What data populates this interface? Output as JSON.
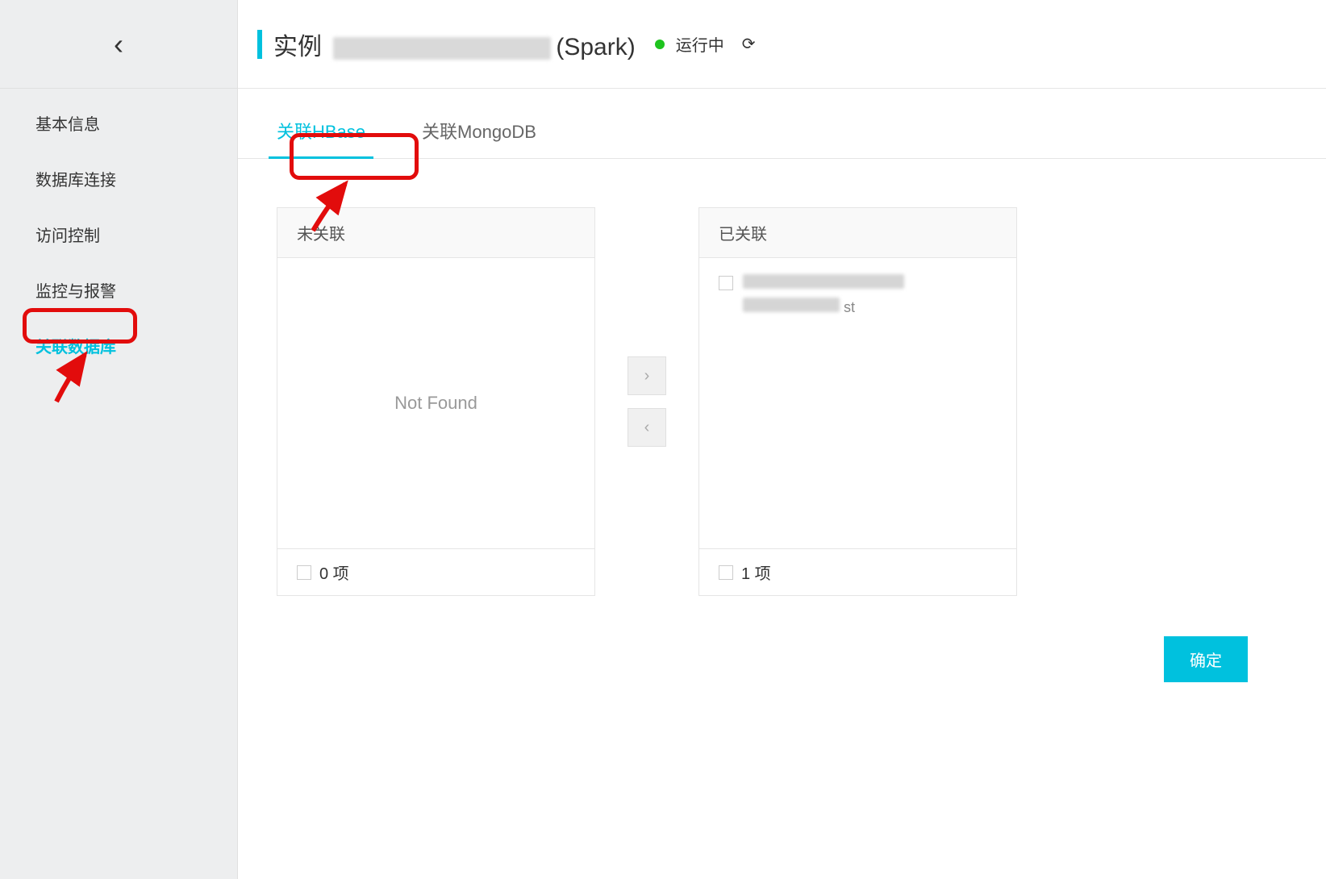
{
  "sidebar": {
    "items": [
      {
        "label": "基本信息",
        "active": false
      },
      {
        "label": "数据库连接",
        "active": false
      },
      {
        "label": "访问控制",
        "active": false
      },
      {
        "label": "监控与报警",
        "active": false
      },
      {
        "label": "关联数据库",
        "active": true
      }
    ]
  },
  "header": {
    "title_prefix": "实例",
    "title_suffix": "(Spark)",
    "status": "运行中"
  },
  "tabs": [
    {
      "label": "关联HBase",
      "active": true
    },
    {
      "label": "关联MongoDB",
      "active": false
    }
  ],
  "transfer": {
    "left": {
      "header": "未关联",
      "empty_text": "Not Found",
      "footer_count": "0 项"
    },
    "right": {
      "header": "已关联",
      "footer_count": "1 项"
    }
  },
  "buttons": {
    "confirm": "确定"
  }
}
